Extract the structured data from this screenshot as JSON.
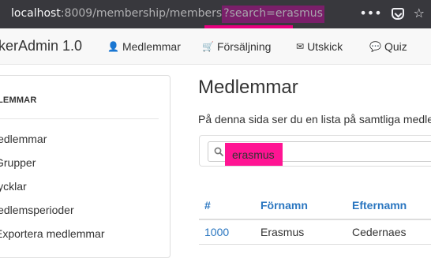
{
  "browser": {
    "url_host": "localhost",
    "url_path": ":8009/membership/members",
    "url_query": "?search=erasmus",
    "actions": {
      "more": "•••",
      "pocket": "pocket-icon",
      "star": "☆"
    }
  },
  "navbar": {
    "brand": "kerAdmin 1.0",
    "items": [
      {
        "icon": "👤",
        "label": "Medlemmar"
      },
      {
        "icon": "🛒",
        "label": "Försäljning"
      },
      {
        "icon": "✉",
        "label": "Utskick"
      },
      {
        "icon": "💬",
        "label": "Quiz"
      }
    ]
  },
  "sidebar": {
    "title": "LEMMAR",
    "items": [
      {
        "label": "ledlemmar"
      },
      {
        "label": "Grupper"
      },
      {
        "label": "lycklar"
      },
      {
        "label": "ledlemsperioder"
      },
      {
        "label": "Exportera medlemmar"
      }
    ]
  },
  "main": {
    "title": "Medlemmar",
    "description": "På denna sida ser du en lista på samtliga medle",
    "search": {
      "value": "erasmus",
      "highlight_color": "#ff1493"
    },
    "table": {
      "headers": [
        "#",
        "Förnamn",
        "Efternamn"
      ],
      "rows": [
        {
          "id": "1000",
          "first": "Erasmus",
          "last": "Cedernaes"
        }
      ]
    }
  },
  "colors": {
    "link": "#2a76c0",
    "browser_bar": "#38383d",
    "annotation": "#e6007e"
  }
}
